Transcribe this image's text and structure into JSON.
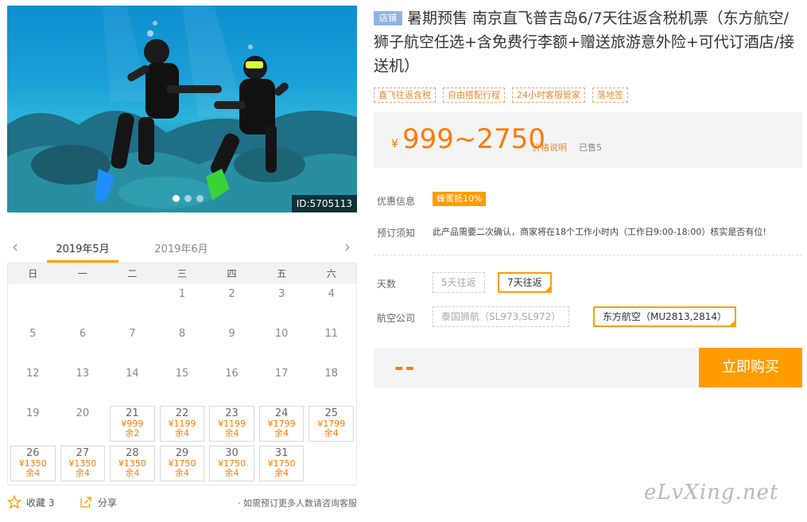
{
  "gallery": {
    "id_tag": "ID:5705113",
    "slide_count": 3,
    "active_slide": 1
  },
  "calendar": {
    "prev_icon": "chevron-left-icon",
    "next_icon": "chevron-right-icon",
    "months": [
      "2019年5月",
      "2019年6月"
    ],
    "active_month": 0,
    "weekdays": [
      "日",
      "一",
      "二",
      "三",
      "四",
      "五",
      "六"
    ],
    "leading_blanks": 3,
    "days": [
      {
        "d": "1"
      },
      {
        "d": "2"
      },
      {
        "d": "3"
      },
      {
        "d": "4"
      },
      {
        "d": "5"
      },
      {
        "d": "6"
      },
      {
        "d": "7"
      },
      {
        "d": "8"
      },
      {
        "d": "9"
      },
      {
        "d": "10"
      },
      {
        "d": "11"
      },
      {
        "d": "12"
      },
      {
        "d": "13"
      },
      {
        "d": "14"
      },
      {
        "d": "15"
      },
      {
        "d": "16"
      },
      {
        "d": "17"
      },
      {
        "d": "18"
      },
      {
        "d": "19"
      },
      {
        "d": "20"
      },
      {
        "d": "21",
        "price": "¥999",
        "stock": "余2"
      },
      {
        "d": "22",
        "price": "¥1199",
        "stock": "余4"
      },
      {
        "d": "23",
        "price": "¥1199",
        "stock": "余4"
      },
      {
        "d": "24",
        "price": "¥1799",
        "stock": "余4"
      },
      {
        "d": "25",
        "price": "¥1799",
        "stock": "余4"
      },
      {
        "d": "26",
        "price": "¥1350",
        "stock": "余4"
      },
      {
        "d": "27",
        "price": "¥1350",
        "stock": "余4"
      },
      {
        "d": "28",
        "price": "¥1350",
        "stock": "余4"
      },
      {
        "d": "29",
        "price": "¥1750",
        "stock": "余4"
      },
      {
        "d": "30",
        "price": "¥1750",
        "stock": "余4"
      },
      {
        "d": "31",
        "price": "¥1750",
        "stock": "余4"
      }
    ]
  },
  "footer": {
    "fav_icon": "star-icon",
    "fav_label": "收藏 3",
    "share_icon": "share-icon",
    "share_label": "分享",
    "hint": "· 如需预订更多人数请咨询客服"
  },
  "product": {
    "shop_badge": "店铺",
    "title": "暑期预售 南京直飞普吉岛6/7天往返含税机票（东方航空/狮子航空任选+含免费行李额+赠送旅游意外险+可代订酒店/接送机）",
    "tags": [
      "直飞往返含税",
      "自由搭配行程",
      "24小时客服管家",
      "落地签"
    ]
  },
  "price": {
    "currency": "¥",
    "range": "999~2750",
    "explain": "价格说明",
    "sold": "已售5"
  },
  "info": {
    "discount_label": "优惠信息",
    "discount_badge": "蜂蜜抵10%",
    "notice_label": "预订须知",
    "notice_text": "此产品需要二次确认，商家将在18个工作小时内（工作日9:00-18:00）核实是否有位!"
  },
  "options": {
    "days_label": "天数",
    "days": [
      {
        "label": "5天往返",
        "selected": false
      },
      {
        "label": "7天往返",
        "selected": true
      }
    ],
    "airline_label": "航空公司",
    "airlines": [
      {
        "label": "泰国狮航（SL973,SL972）",
        "selected": false
      },
      {
        "label": "东方航空（MU2813,2814）",
        "selected": true
      }
    ]
  },
  "buy": {
    "total": "--",
    "button": "立即购买"
  },
  "watermark": "eLvXing.net",
  "colors": {
    "accent": "#ff9d00",
    "price": "#ff7a00",
    "shop_badge": "#8fb4e0"
  }
}
